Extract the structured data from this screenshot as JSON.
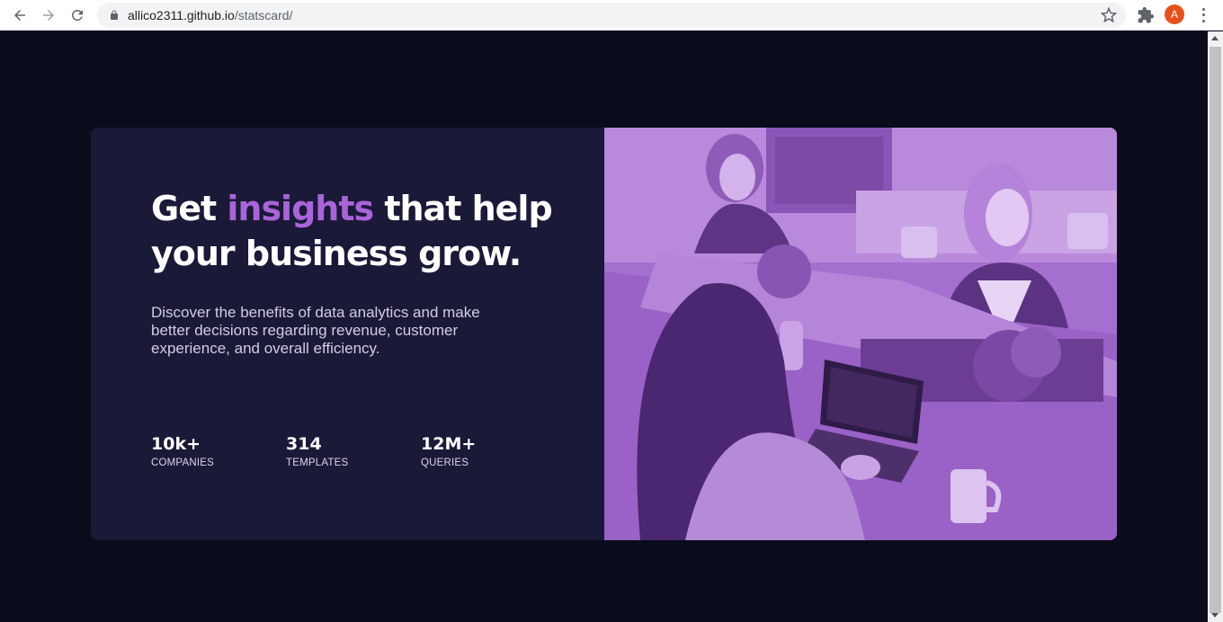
{
  "browser": {
    "url_host": "allico2311.github.io",
    "url_path": "/statscard/",
    "avatar_letter": "A"
  },
  "card": {
    "headline_part1": "Get ",
    "headline_accent": "insights",
    "headline_part2": " that help your business grow.",
    "description": "Discover the benefits of data analytics and make better decisions regarding revenue, customer experience, and overall efficiency.",
    "stats": [
      {
        "value": "10k+",
        "label": "COMPANIES"
      },
      {
        "value": "314",
        "label": "TEMPLATES"
      },
      {
        "value": "12M+",
        "label": "QUERIES"
      }
    ]
  },
  "colors": {
    "page_bg": "#0a0c1c",
    "card_bg": "#1b1938",
    "accent": "#a964d9",
    "image_tint": "#9b61c8"
  }
}
